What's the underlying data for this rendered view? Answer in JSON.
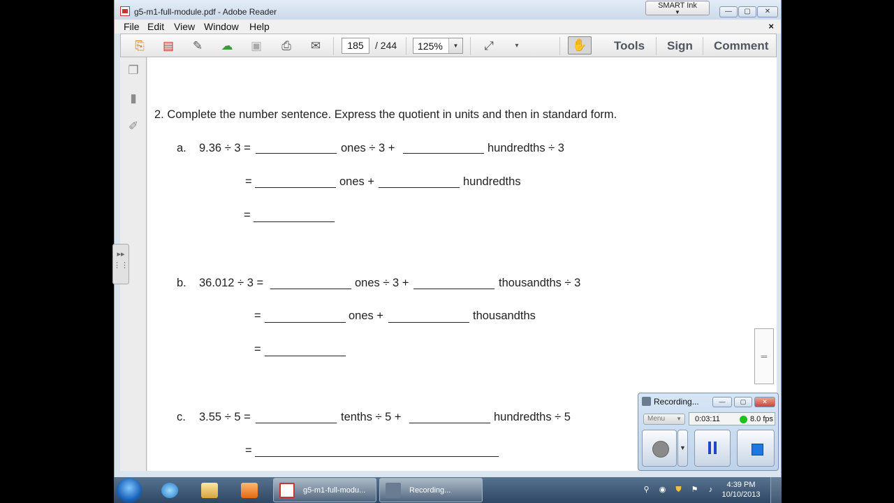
{
  "window": {
    "title": "g5-m1-full-module.pdf - Adobe Reader",
    "smart_ink": "SMART Ink",
    "min": "▭",
    "max": "▢",
    "close": "✕"
  },
  "menu": [
    "File",
    "Edit",
    "View",
    "Window",
    "Help"
  ],
  "menu_close": "×",
  "toolbar": {
    "page_current": "185",
    "page_total": "/ 244",
    "zoom": "125%",
    "tools_label": "Tools",
    "sign_label": "Sign",
    "comment_label": "Comment"
  },
  "icons": {
    "create": "create-pdf-icon",
    "convert": "convert-icon",
    "edit": "edit-icon",
    "upload": "upload-cloud-icon",
    "save": "save-icon",
    "print": "print-icon",
    "email": "email-icon",
    "fit": "fit-page-icon",
    "hand": "hand-tool-icon"
  },
  "document": {
    "question": "2.     Complete the number sentence.  Express the quotient in units and then in standard form.",
    "a": {
      "label": "a.",
      "line1_prefix": "9.36 ÷ 3 =",
      "line1_mid": "ones ÷ 3  +",
      "line1_end": "hundredths  ÷ 3",
      "line2_eq": "=",
      "line2_mid": "ones +",
      "line2_end": "hundredths",
      "line3_eq": "="
    },
    "b": {
      "label": "b.",
      "line1_prefix": "36.012 ÷ 3 =",
      "line1_mid": "ones ÷ 3 +",
      "line1_end": "thousandths ÷ 3",
      "line2_eq": "=",
      "line2_mid": "ones +",
      "line2_end": "thousandths",
      "line3_eq": "="
    },
    "c": {
      "label": "c.",
      "line1_prefix": "3.55 ÷ 5 =",
      "line1_mid": "tenths ÷ 5 +",
      "line1_end": "hundredths ÷ 5",
      "line2_eq": "="
    }
  },
  "recorder": {
    "title": "Recording...",
    "menu": "Menu",
    "elapsed": "0:03:11",
    "fps": "8.0 fps",
    "status_color": "#1ac21a"
  },
  "taskbar": {
    "task_pdf": "g5-m1-full-modu...",
    "task_rec": "Recording...",
    "time": "4:39 PM",
    "date": "10/10/2013"
  }
}
